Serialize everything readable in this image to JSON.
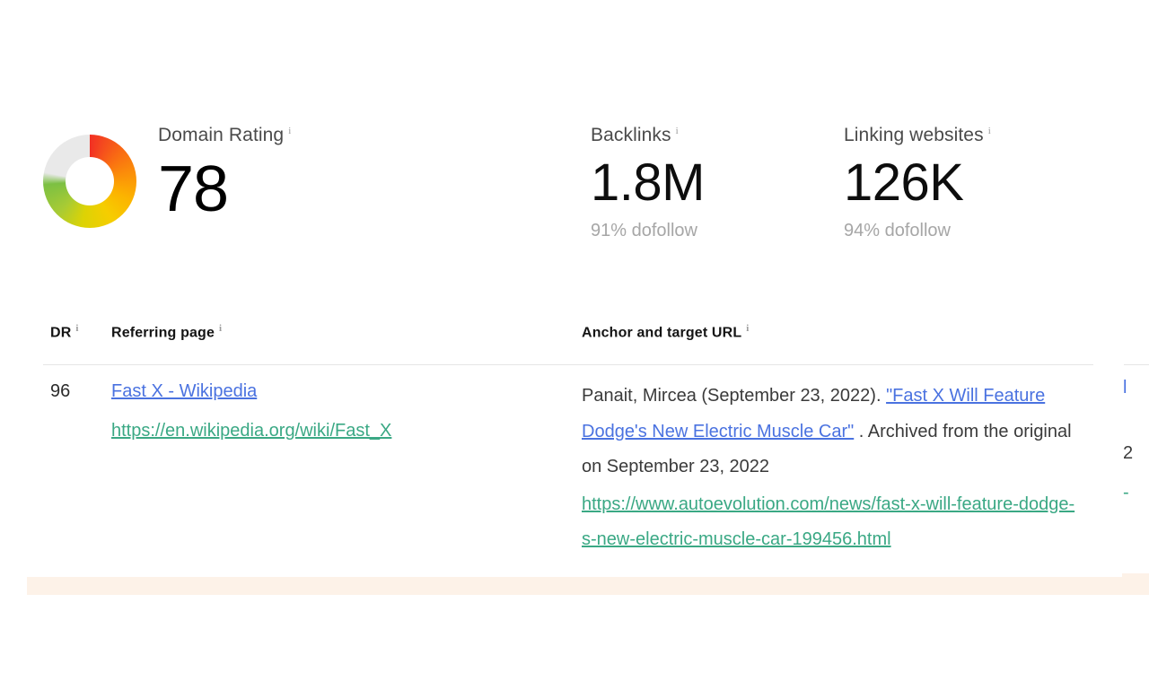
{
  "metrics": {
    "domain_rating": {
      "label": "Domain Rating",
      "value": "78",
      "info_icon": "info-icon",
      "gauge_max": 100,
      "ring_colors": [
        "#f22f23",
        "#fb8c0a",
        "#f6cd00",
        "#7cc043",
        "#e9e9e9"
      ]
    },
    "backlinks": {
      "label": "Backlinks",
      "value": "1.8M",
      "sub": "91% dofollow",
      "info_icon": "info-icon"
    },
    "linking_websites": {
      "label": "Linking websites",
      "value": "126K",
      "sub": "94% dofollow",
      "info_icon": "info-icon"
    }
  },
  "table": {
    "headers": {
      "dr": "DR",
      "referring_page": "Referring page",
      "anchor_and_target": "Anchor and target URL"
    },
    "rows": [
      {
        "dr": "96",
        "referring_page_title": "Fast X - Wikipedia",
        "referring_page_url": "https://en.wikipedia.org/wiki/Fast_X",
        "anchor_prefix": "Panait, Mircea (September 23, 2022). ",
        "anchor_link": "\"Fast X Will Feature Dodge's New Electric Muscle Car\"",
        "anchor_suffix": " . Archived from the original on September 23, 2022",
        "target_url": "https://www.autoevolution.com/news/fast-x-will-feature-dodge-s-new-electric-muscle-car-199456.html"
      }
    ],
    "clipped_column": {
      "link_fragment": "l",
      "number_fragment": "2",
      "dash_fragment": "-"
    }
  },
  "colors": {
    "link_blue": "#4a72e0",
    "url_green": "#3aa884",
    "body_text": "#3a3a3a",
    "muted_text": "#a6a6a6",
    "band_cream": "#fdf2e8"
  }
}
